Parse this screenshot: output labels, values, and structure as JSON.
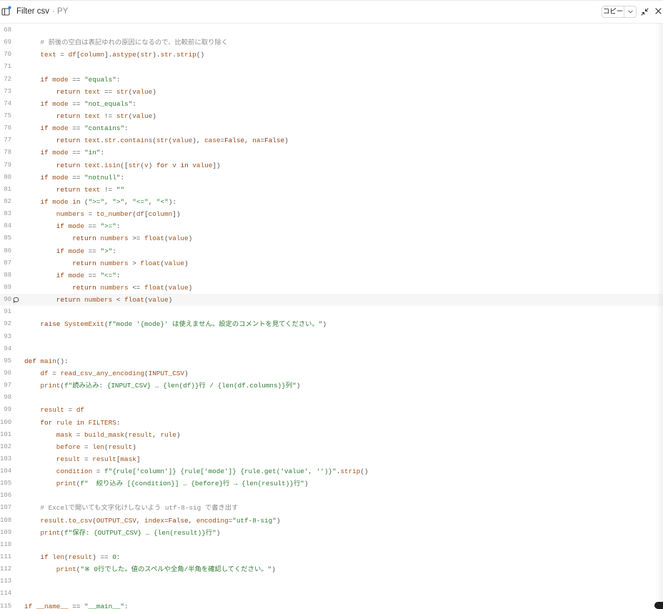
{
  "window": {
    "title": "Filter csv",
    "file_type": "· PY",
    "copy_label": "コピー",
    "status_dot_color": "#2f7cf6",
    "icons": {
      "sidebar": "panel-toggle-icon",
      "copy_menu": "chevron-down-icon",
      "collapse": "collapse-icon",
      "close": "close-icon"
    }
  },
  "syntax": {
    "identifier": "#a0521a",
    "function": "#a0521a",
    "builtin": "#a0521a",
    "keyword": "#8f3d12",
    "constant": "#8f3d12",
    "string": "#2f7d32",
    "number": "#2f7d32",
    "comment": "#8c8c8c",
    "operator": "#505050",
    "line_number": "#9a9a9a",
    "active_line": "#f6f6f6"
  },
  "editor": {
    "gutter_icon": "comment-icon",
    "lines": [
      {
        "n": "68",
        "text": ""
      },
      {
        "n": "69",
        "text": "    # 前後の空白は表記ゆれの原因になるので、比較前に取り除く"
      },
      {
        "n": "70",
        "text": "    text = df[column].astype(str).str.strip()"
      },
      {
        "n": "71",
        "text": ""
      },
      {
        "n": "72",
        "text": "    if mode == \"equals\":"
      },
      {
        "n": "73",
        "text": "        return text == str(value)"
      },
      {
        "n": "74",
        "text": "    if mode == \"not_equals\":"
      },
      {
        "n": "75",
        "text": "        return text != str(value)"
      },
      {
        "n": "76",
        "text": "    if mode == \"contains\":"
      },
      {
        "n": "77",
        "text": "        return text.str.contains(str(value), case=False, na=False)"
      },
      {
        "n": "78",
        "text": "    if mode == \"in\":"
      },
      {
        "n": "79",
        "text": "        return text.isin([str(v) for v in value])"
      },
      {
        "n": "80",
        "text": "    if mode == \"notnull\":"
      },
      {
        "n": "81",
        "text": "        return text != \"\""
      },
      {
        "n": "82",
        "text": "    if mode in (\">=\", \">\", \"<=\", \"<\"):"
      },
      {
        "n": "83",
        "text": "        numbers = to_number(df[column])"
      },
      {
        "n": "84",
        "text": "        if mode == \">=\":"
      },
      {
        "n": "85",
        "text": "            return numbers >= float(value)"
      },
      {
        "n": "86",
        "text": "        if mode == \">\":"
      },
      {
        "n": "87",
        "text": "            return numbers > float(value)"
      },
      {
        "n": "88",
        "text": "        if mode == \"<=\":"
      },
      {
        "n": "89",
        "text": "            return numbers <= float(value)"
      },
      {
        "n": "90",
        "text": "        return numbers < float(value)",
        "active": true,
        "comment": true
      },
      {
        "n": "91",
        "text": ""
      },
      {
        "n": "92",
        "text": "    raise SystemExit(f\"mode '{mode}' は使えません。設定のコメントを見てください。\")"
      },
      {
        "n": "93",
        "text": ""
      },
      {
        "n": "94",
        "text": ""
      },
      {
        "n": "95",
        "text": "def main():"
      },
      {
        "n": "96",
        "text": "    df = read_csv_any_encoding(INPUT_CSV)"
      },
      {
        "n": "97",
        "text": "    print(f\"読み込み: {INPUT_CSV} … {len(df)}行 / {len(df.columns)}列\")"
      },
      {
        "n": "98",
        "text": ""
      },
      {
        "n": "99",
        "text": "    result = df"
      },
      {
        "n": "100",
        "text": "    for rule in FILTERS:"
      },
      {
        "n": "101",
        "text": "        mask = build_mask(result, rule)"
      },
      {
        "n": "102",
        "text": "        before = len(result)"
      },
      {
        "n": "103",
        "text": "        result = result[mask]"
      },
      {
        "n": "104",
        "text": "        condition = f\"{rule['column']} {rule['mode']} {rule.get('value', '')}\".strip()"
      },
      {
        "n": "105",
        "text": "        print(f\"  絞り込み [{condition}] … {before}行 → {len(result)}行\")"
      },
      {
        "n": "106",
        "text": ""
      },
      {
        "n": "107",
        "text": "    # Excelで開いても文字化けしないよう utf-8-sig で書き出す"
      },
      {
        "n": "108",
        "text": "    result.to_csv(OUTPUT_CSV, index=False, encoding=\"utf-8-sig\")"
      },
      {
        "n": "109",
        "text": "    print(f\"保存: {OUTPUT_CSV} … {len(result)}行\")"
      },
      {
        "n": "110",
        "text": ""
      },
      {
        "n": "111",
        "text": "    if len(result) == 0:"
      },
      {
        "n": "112",
        "text": "        print(\"※ 0行でした。値のスペルや全角/半角を確認してください。\")"
      },
      {
        "n": "113",
        "text": ""
      },
      {
        "n": "114",
        "text": ""
      },
      {
        "n": "115",
        "text": "if __name__ == \"__main__\":"
      }
    ]
  }
}
